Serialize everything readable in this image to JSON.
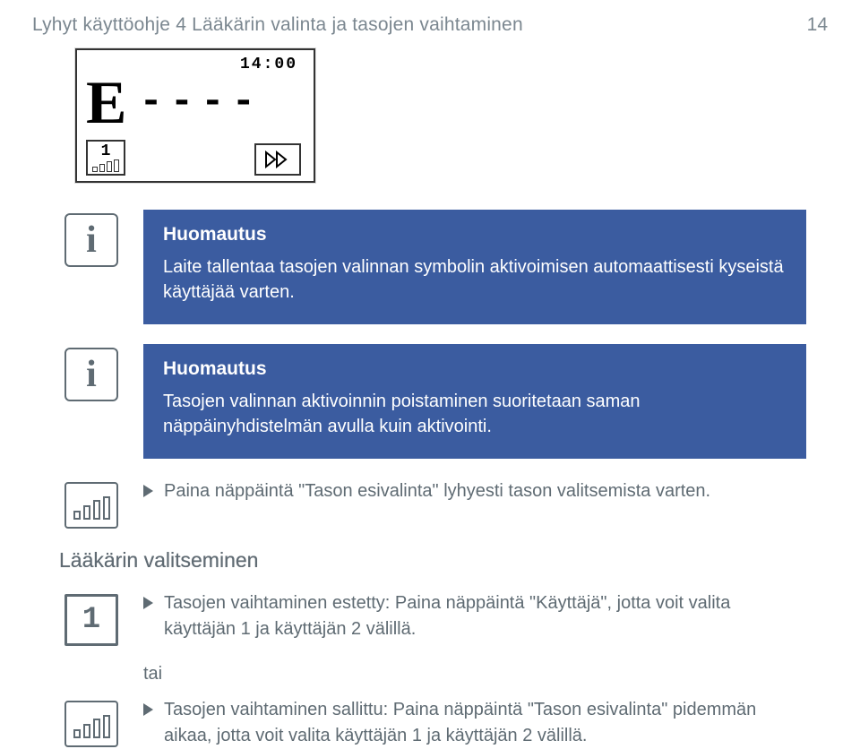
{
  "header": {
    "title": "Lyhyt käyttöohje 4 Lääkärin valinta ja tasojen vaihtaminen",
    "page": "14"
  },
  "lcd": {
    "time": "14:00",
    "letter": "E",
    "dashes": "----",
    "user_num": "1"
  },
  "note1": {
    "heading": "Huomautus",
    "body": "Laite tallentaa tasojen valinnan symbolin aktivoimisen automaattisesti kyseistä käyttäjää varten."
  },
  "note2": {
    "heading": "Huomautus",
    "body": "Tasojen valinnan aktivoinnin poistaminen suoritetaan saman näppäinyhdistelmän avulla kuin aktivointi."
  },
  "level_instruction": "Paina näppäintä \"Tason esivalinta\" lyhyesti tason valitsemista varten.",
  "section_heading": "Lääkärin valitseminen",
  "user1_instruction": "Tasojen vaihtaminen estetty: Paina näppäintä \"Käyttäjä\", jotta voit valita käyttäjän 1 ja käyttäjän 2 välillä.",
  "tai_label": "tai",
  "level2_instruction": "Tasojen vaihtaminen sallittu: Paina näppäintä \"Tason esivalinta\" pidemmän aikaa, jotta voit valita käyttäjän 1 ja käyttäjän 2 välillä."
}
